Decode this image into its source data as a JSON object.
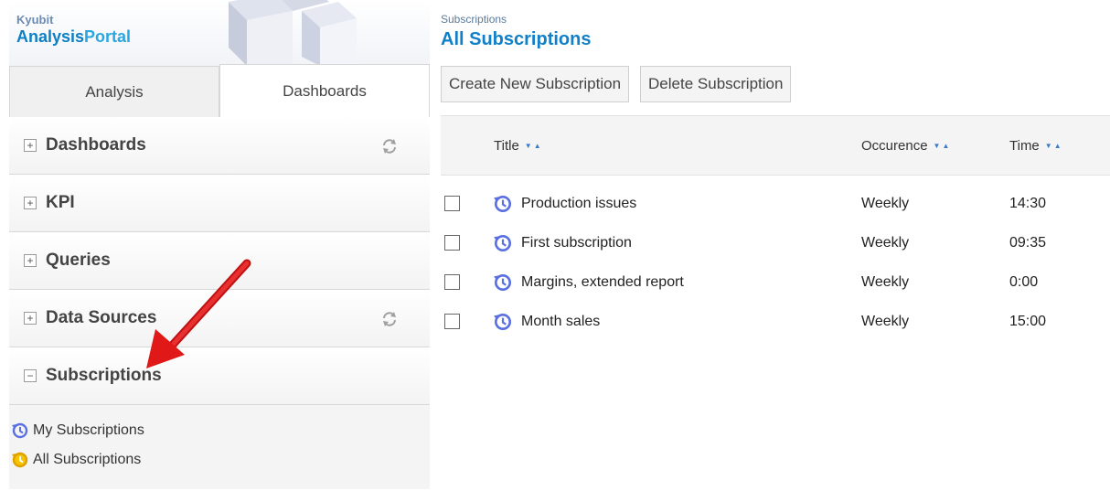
{
  "brand": {
    "company": "Kyubit",
    "product_part1": "Analysis",
    "product_part2": "Portal"
  },
  "tabs": [
    {
      "label": "Analysis"
    },
    {
      "label": "Dashboards"
    }
  ],
  "sections": [
    {
      "toggle": "+",
      "label": "Dashboards",
      "has_refresh": true
    },
    {
      "toggle": "+",
      "label": "KPI",
      "has_refresh": false
    },
    {
      "toggle": "+",
      "label": "Queries",
      "has_refresh": false
    },
    {
      "toggle": "+",
      "label": "Data Sources",
      "has_refresh": true
    },
    {
      "toggle": "−",
      "label": "Subscriptions",
      "has_refresh": false
    }
  ],
  "subscription_links": [
    {
      "label": "My Subscriptions",
      "icon": "clock-history-icon",
      "color": "#5a6fe0"
    },
    {
      "label": "All Subscriptions",
      "icon": "clock-history-icon",
      "color": "#f0b400"
    }
  ],
  "breadcrumb": "Subscriptions",
  "page_title": "All Subscriptions",
  "toolbar": {
    "create_label": "Create New Subscription",
    "delete_label": "Delete Subscription"
  },
  "table": {
    "columns": [
      "Title",
      "Occurence",
      "Time"
    ],
    "rows": [
      {
        "title": "Production issues",
        "occurrence": "Weekly",
        "time": "14:30"
      },
      {
        "title": "First subscription",
        "occurrence": "Weekly",
        "time": "09:35"
      },
      {
        "title": "Margins, extended report",
        "occurrence": "Weekly",
        "time": "0:00"
      },
      {
        "title": "Month sales",
        "occurrence": "Weekly",
        "time": "15:00"
      }
    ]
  },
  "colors": {
    "accent": "#1180c8",
    "arrow": "#e01818",
    "icon_blue": "#5a6fe0",
    "icon_gold": "#f0b400"
  }
}
